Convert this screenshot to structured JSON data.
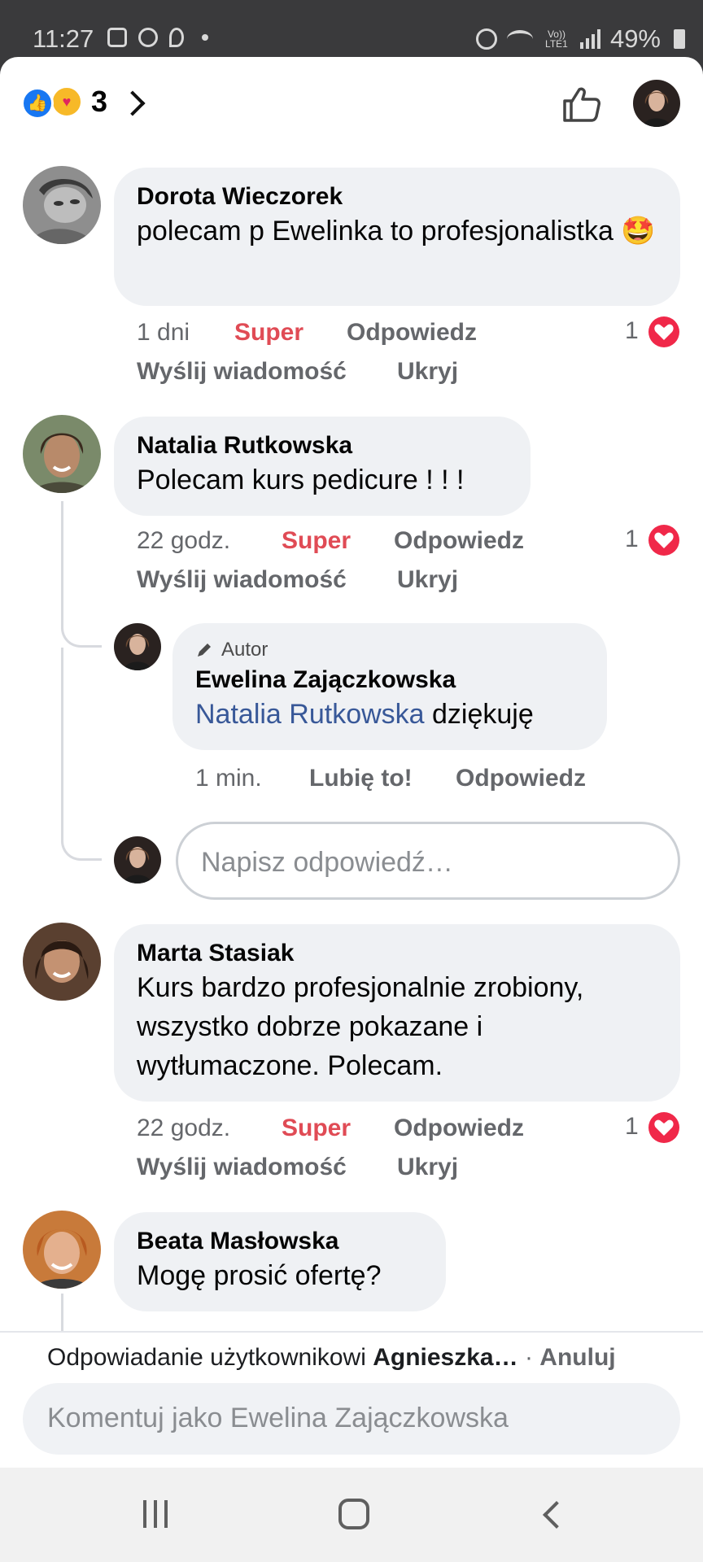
{
  "status_bar": {
    "time": "11:27",
    "network_label": "Vo)) LTE1",
    "battery": "49%"
  },
  "reactions": {
    "count": "3",
    "types": [
      "like",
      "care"
    ]
  },
  "comments": [
    {
      "author": "Dorota Wieczorek",
      "text": "polecam p Ewelinka to profesjonalistka",
      "emoji": "🤩",
      "time": "1 dni",
      "reaction_label": "Super",
      "reply_label": "Odpowiedz",
      "message_label": "Wyślij wiadomość",
      "hide_label": "Ukryj",
      "like_count": "1"
    },
    {
      "author": "Natalia Rutkowska",
      "text": "Polecam kurs pedicure ! ! !",
      "time": "22 godz.",
      "reaction_label": "Super",
      "reply_label": "Odpowiedz",
      "message_label": "Wyślij wiadomość",
      "hide_label": "Ukryj",
      "like_count": "1"
    },
    {
      "author": "Marta Stasiak",
      "text": "Kurs bardzo profesjonalnie zrobiony, wszystko dobrze pokazane i wytłumaczone. Polecam.",
      "time": "22 godz.",
      "reaction_label": "Super",
      "reply_label": "Odpowiedz",
      "message_label": "Wyślij wiadomość",
      "hide_label": "Ukryj",
      "like_count": "1"
    },
    {
      "author": "Beata Masłowska",
      "text": "Mogę prosić ofertę?"
    }
  ],
  "reply": {
    "author_tag": "Autor",
    "author": "Ewelina Zajączkowska",
    "mention": "Natalia Rutkowska",
    "text": "dziękuję",
    "time": "1 min.",
    "like_label": "Lubię to!",
    "reply_label": "Odpowiedz"
  },
  "reply_input": {
    "placeholder": "Napisz odpowiedź…"
  },
  "footer": {
    "replying_prefix": "Odpowiadanie użytkownikowi",
    "replying_user": "Agnieszka…",
    "separator": "·",
    "cancel_label": "Anuluj",
    "comment_placeholder": "Komentuj jako Ewelina Zajączkowska"
  },
  "colors": {
    "accent_red": "#e04b55",
    "link_blue": "#385898",
    "bubble_bg": "#eff1f4",
    "like_blue": "#1877f2",
    "heart_red": "#f02849"
  },
  "icons": [
    "like-reaction-icon",
    "care-reaction-icon",
    "chevron-right-icon",
    "thumbs-up-icon",
    "heart-icon",
    "pencil-icon",
    "recent-apps-icon",
    "home-icon",
    "back-icon"
  ]
}
